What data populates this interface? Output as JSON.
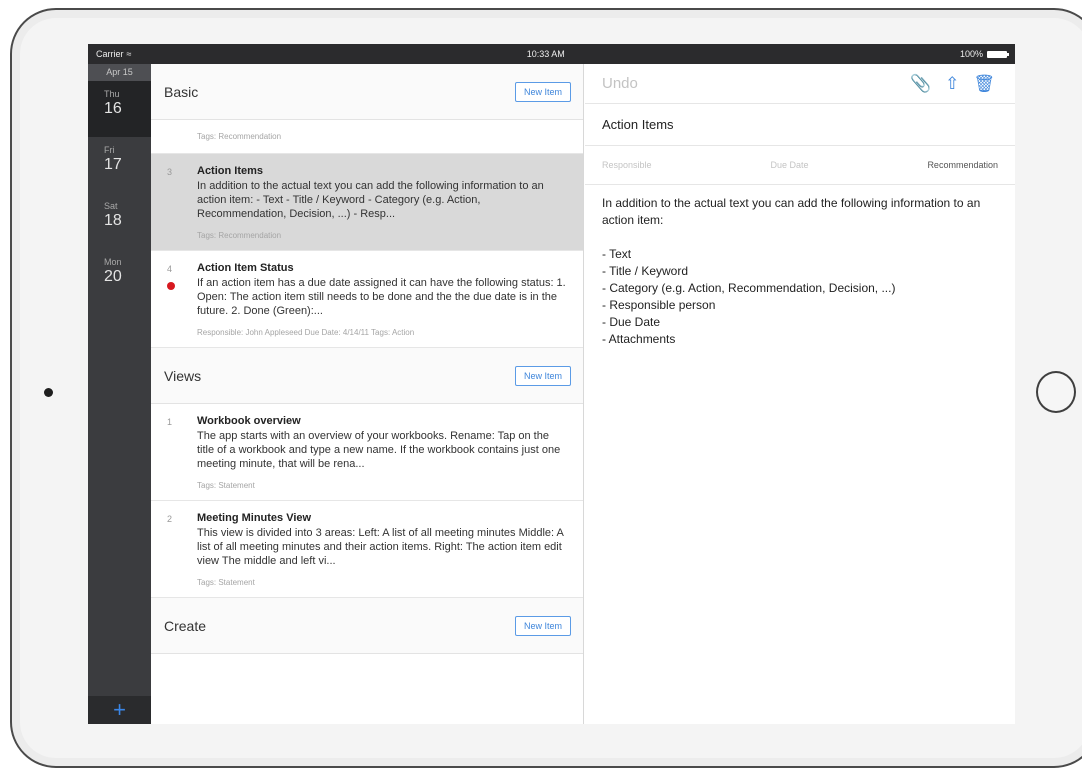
{
  "status_bar": {
    "carrier": "Carrier",
    "time": "10:33 AM",
    "battery": "100%"
  },
  "dates": {
    "month": "Apr 15",
    "items": [
      {
        "dow": "Thu",
        "day": "16"
      },
      {
        "dow": "Fri",
        "day": "17"
      },
      {
        "dow": "Sat",
        "day": "18"
      },
      {
        "dow": "Mon",
        "day": "20"
      }
    ],
    "add_label": "+"
  },
  "list": {
    "sections": [
      {
        "title": "Basic",
        "new_item": "New Item",
        "top_tags": "Tags: Recommendation",
        "items": [
          {
            "num": "3",
            "title": "Action Items",
            "body": "In addition to the actual text you can add the following information to an action item:  - Text - Title / Keyword - Category (e.g. Action, Recommendation, Decision, ...) - Resp...",
            "meta": "Tags: Recommendation"
          },
          {
            "num": "4",
            "title": "Action Item Status",
            "body": "If an action item has a due date assigned it can have the following status:  1. Open: The action item still needs to be done and the the due date is in the future.  2. Done (Green):...",
            "meta": "Responsible: John Appleseed    Due Date: 4/14/11    Tags: Action"
          }
        ]
      },
      {
        "title": "Views",
        "new_item": "New Item",
        "items": [
          {
            "num": "1",
            "title": "Workbook overview",
            "body": "The app starts with an overview of your workbooks.  Rename: Tap on the title of a workbook and type a new name. If the workbook contains just one meeting minute, that will be rena...",
            "meta": "Tags: Statement"
          },
          {
            "num": "2",
            "title": "Meeting Minutes View",
            "body": "This view is divided into 3 areas:  Left: A list of all meeting minutes Middle: A list of all meeting minutes and their action items. Right: The action item edit view  The middle and left vi...",
            "meta": "Tags: Statement"
          }
        ]
      },
      {
        "title": "Create",
        "new_item": "New Item"
      }
    ]
  },
  "detail": {
    "undo": "Undo",
    "title": "Action Items",
    "responsible_placeholder": "Responsible",
    "due_date_placeholder": "Due Date",
    "category": "Recommendation",
    "content": "In addition to the actual text you can add the following information to an action item:\n\n- Text\n- Title / Keyword\n- Category (e.g. Action, Recommendation, Decision, ...)\n- Responsible person\n- Due Date\n- Attachments"
  }
}
